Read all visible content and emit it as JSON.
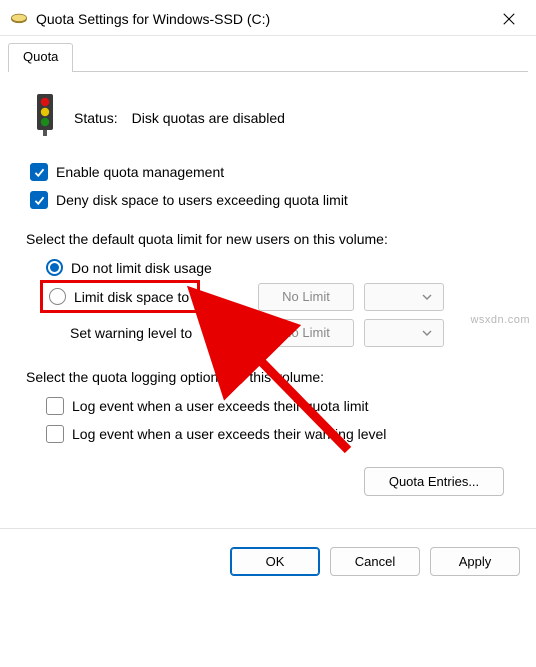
{
  "title": "Quota Settings for Windows-SSD (C:)",
  "tab": {
    "label": "Quota"
  },
  "status": {
    "label": "Status:",
    "value": "Disk quotas are disabled"
  },
  "checks": {
    "enable": "Enable quota management",
    "deny": "Deny disk space to users exceeding quota limit"
  },
  "limit_section": {
    "heading": "Select the default quota limit for new users on this volume:",
    "no_limit_radio": "Do not limit disk usage",
    "limit_radio": "Limit disk space to",
    "warning_label": "Set warning level to",
    "value_placeholder": "No Limit"
  },
  "log_section": {
    "heading": "Select the quota logging options for this volume:",
    "log_exceed_limit": "Log event when a user exceeds their quota limit",
    "log_exceed_warning": "Log event when a user exceeds their warning level"
  },
  "buttons": {
    "quota_entries": "Quota Entries...",
    "ok": "OK",
    "cancel": "Cancel",
    "apply": "Apply"
  },
  "watermark": "wsxdn.com"
}
